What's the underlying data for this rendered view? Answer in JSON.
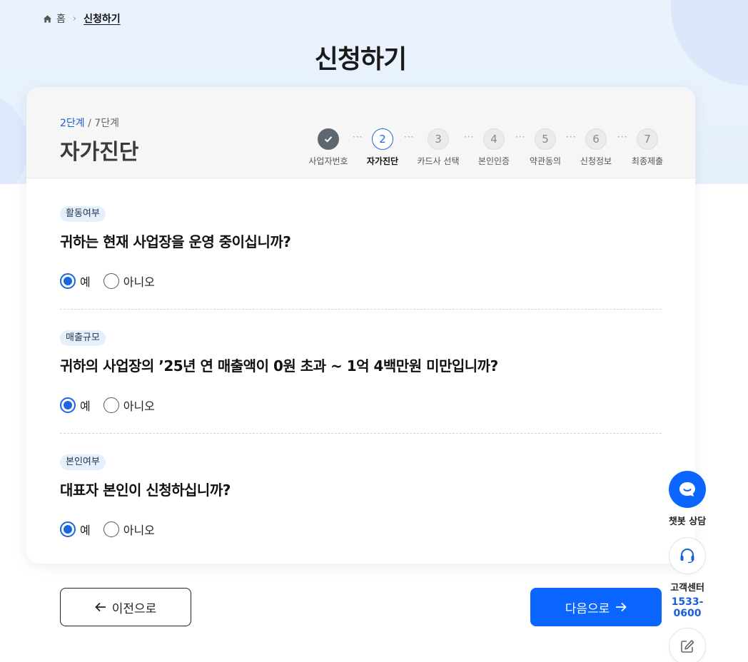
{
  "breadcrumb": {
    "home": "홈",
    "current": "신청하기"
  },
  "page": {
    "title": "신청하기"
  },
  "progress": {
    "current_step": "2단계",
    "separator": "/",
    "total_steps": "7단계",
    "step_name": "자가진단",
    "steps": [
      {
        "number": "",
        "label": "사업자번호",
        "state": "done"
      },
      {
        "number": "2",
        "label": "자가진단",
        "state": "active"
      },
      {
        "number": "3",
        "label": "카드사 선택",
        "state": "pending"
      },
      {
        "number": "4",
        "label": "본인인증",
        "state": "pending"
      },
      {
        "number": "5",
        "label": "약관동의",
        "state": "pending"
      },
      {
        "number": "6",
        "label": "신청정보",
        "state": "pending"
      },
      {
        "number": "7",
        "label": "최종제출",
        "state": "pending"
      }
    ],
    "connector": "···"
  },
  "questions": [
    {
      "tag": "활동여부",
      "text": "귀하는 현재 사업장을 운영 중이십니까?",
      "yes": "예",
      "no": "아니오",
      "selected": "yes"
    },
    {
      "tag": "매출규모",
      "text": "귀하의 사업장의 ’25년 연 매출액이 0원 초과 ~ 1억 4백만원 미만입니까?",
      "yes": "예",
      "no": "아니오",
      "selected": "yes"
    },
    {
      "tag": "본인여부",
      "text": "대표자 본인이 신청하십니까?",
      "yes": "예",
      "no": "아니오",
      "selected": "yes"
    }
  ],
  "nav": {
    "prev_label": "이전으로",
    "next_label": "다음으로"
  },
  "side": {
    "chatbot_label": "챗봇 상담",
    "cs_label": "고객센터",
    "cs_phone": "1533-0600"
  },
  "colors": {
    "primary": "#0a66ff",
    "accent_text": "#1a5fd6",
    "done_step": "#5e6670"
  }
}
